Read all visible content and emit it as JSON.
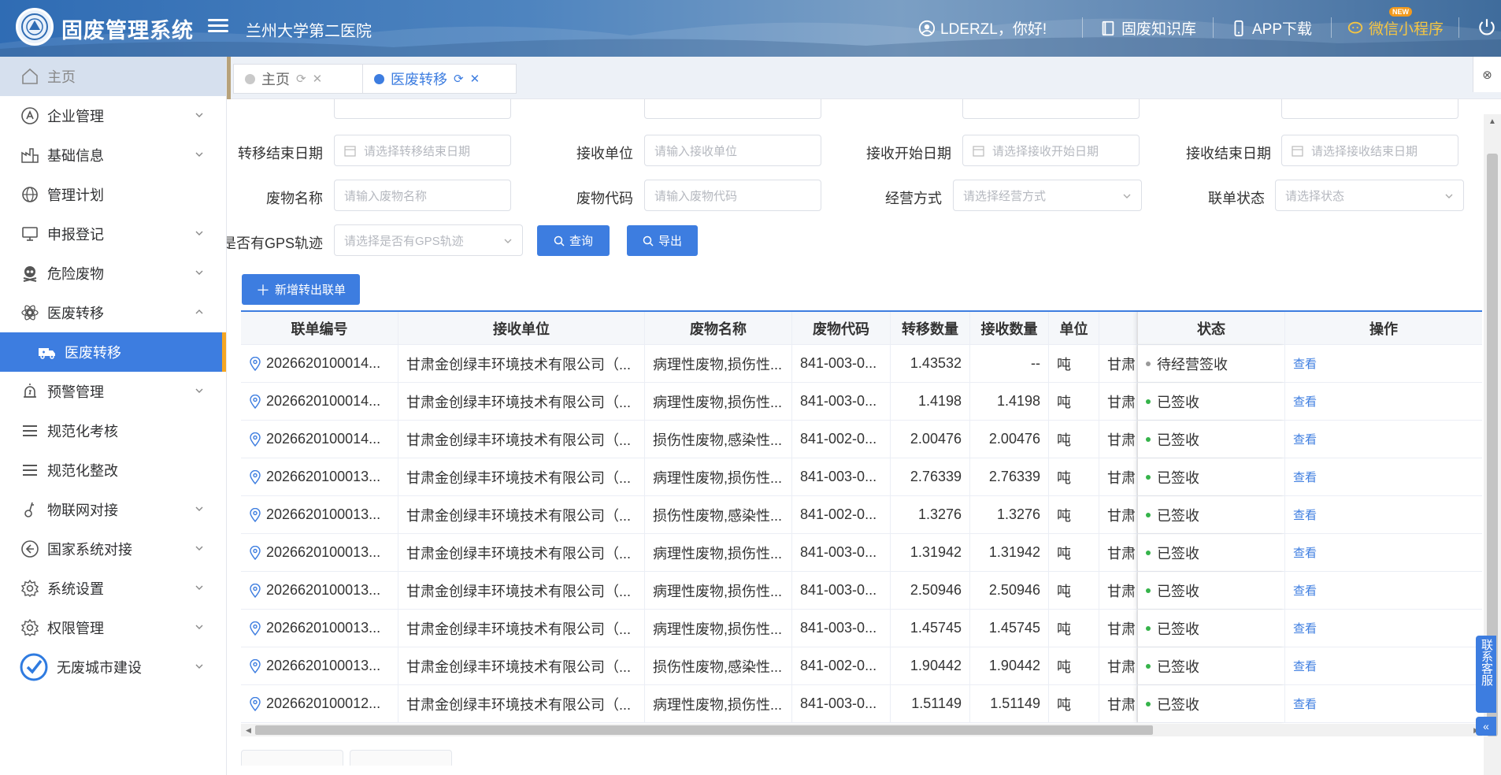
{
  "header": {
    "app_title": "固废管理系统",
    "org_name": "兰州大学第二医院",
    "greeting": "LDERZL，你好!",
    "knowledge": "固废知识库",
    "app_download": "APP下载",
    "mini_program": "微信小程序",
    "new_badge": "NEW"
  },
  "sidebar": {
    "items": [
      {
        "label": "主页",
        "icon": "home-icon"
      },
      {
        "label": "企业管理",
        "icon": "enterprise-icon"
      },
      {
        "label": "基础信息",
        "icon": "factory-icon"
      },
      {
        "label": "管理计划",
        "icon": "globe-icon"
      },
      {
        "label": "申报登记",
        "icon": "monitor-icon"
      },
      {
        "label": "危险废物",
        "icon": "skull-icon"
      },
      {
        "label": "医废转移",
        "icon": "medical-icon"
      },
      {
        "label": "医废转移",
        "icon": "truck-icon"
      },
      {
        "label": "预警管理",
        "icon": "alarm-icon"
      },
      {
        "label": "规范化考核",
        "icon": "list-icon"
      },
      {
        "label": "规范化整改",
        "icon": "list-icon"
      },
      {
        "label": "物联网对接",
        "icon": "iot-icon"
      },
      {
        "label": "国家系统对接",
        "icon": "back-arrow-icon"
      },
      {
        "label": "系统设置",
        "icon": "settings-icon"
      },
      {
        "label": "权限管理",
        "icon": "settings-icon"
      },
      {
        "label": "无废城市建设",
        "icon": "check-circle-icon"
      }
    ]
  },
  "tabs": [
    {
      "label": "主页"
    },
    {
      "label": "医废转移"
    }
  ],
  "filters": {
    "transfer_end_date": {
      "label": "转移结束日期",
      "placeholder": "请选择转移结束日期"
    },
    "receiver": {
      "label": "接收单位",
      "placeholder": "请输入接收单位"
    },
    "receive_start": {
      "label": "接收开始日期",
      "placeholder": "请选择接收开始日期"
    },
    "receive_end": {
      "label": "接收结束日期",
      "placeholder": "请选择接收结束日期"
    },
    "waste_name": {
      "label": "废物名称",
      "placeholder": "请输入废物名称"
    },
    "waste_code": {
      "label": "废物代码",
      "placeholder": "请输入废物代码"
    },
    "operation": {
      "label": "经营方式",
      "placeholder": "请选择经营方式"
    },
    "status": {
      "label": "联单状态",
      "placeholder": "请选择状态"
    },
    "gps": {
      "label": "是否有GPS轨迹",
      "placeholder": "请选择是否有GPS轨迹"
    }
  },
  "buttons": {
    "query": "查询",
    "export": "导出",
    "add": "新增转出联单"
  },
  "table": {
    "headers": [
      "联单编号",
      "接收单位",
      "废物名称",
      "废物代码",
      "转移数量",
      "接收数量",
      "单位",
      "",
      "状态",
      "操作"
    ],
    "rows": [
      {
        "id": "2026620100014...",
        "receiver": "甘肃金创绿丰环境技术有限公司（...",
        "waste": "病理性废物,损伤性...",
        "code": "841-003-0...",
        "qty": "1.43532",
        "recv": "--",
        "unit": "吨",
        "extra": "甘肃",
        "status": "待经营签收",
        "status_color": "#999999",
        "op": "查看"
      },
      {
        "id": "2026620100014...",
        "receiver": "甘肃金创绿丰环境技术有限公司（...",
        "waste": "病理性废物,损伤性...",
        "code": "841-003-0...",
        "qty": "1.4198",
        "recv": "1.4198",
        "unit": "吨",
        "extra": "甘肃",
        "status": "已签收",
        "status_color": "#35b34a",
        "op": "查看"
      },
      {
        "id": "2026620100014...",
        "receiver": "甘肃金创绿丰环境技术有限公司（...",
        "waste": "损伤性废物,感染性...",
        "code": "841-002-0...",
        "qty": "2.00476",
        "recv": "2.00476",
        "unit": "吨",
        "extra": "甘肃",
        "status": "已签收",
        "status_color": "#35b34a",
        "op": "查看"
      },
      {
        "id": "2026620100013...",
        "receiver": "甘肃金创绿丰环境技术有限公司（...",
        "waste": "病理性废物,损伤性...",
        "code": "841-003-0...",
        "qty": "2.76339",
        "recv": "2.76339",
        "unit": "吨",
        "extra": "甘肃",
        "status": "已签收",
        "status_color": "#35b34a",
        "op": "查看"
      },
      {
        "id": "2026620100013...",
        "receiver": "甘肃金创绿丰环境技术有限公司（...",
        "waste": "损伤性废物,感染性...",
        "code": "841-002-0...",
        "qty": "1.3276",
        "recv": "1.3276",
        "unit": "吨",
        "extra": "甘肃",
        "status": "已签收",
        "status_color": "#35b34a",
        "op": "查看"
      },
      {
        "id": "2026620100013...",
        "receiver": "甘肃金创绿丰环境技术有限公司（...",
        "waste": "病理性废物,损伤性...",
        "code": "841-003-0...",
        "qty": "1.31942",
        "recv": "1.31942",
        "unit": "吨",
        "extra": "甘肃",
        "status": "已签收",
        "status_color": "#35b34a",
        "op": "查看"
      },
      {
        "id": "2026620100013...",
        "receiver": "甘肃金创绿丰环境技术有限公司（...",
        "waste": "病理性废物,损伤性...",
        "code": "841-003-0...",
        "qty": "2.50946",
        "recv": "2.50946",
        "unit": "吨",
        "extra": "甘肃",
        "status": "已签收",
        "status_color": "#35b34a",
        "op": "查看"
      },
      {
        "id": "2026620100013...",
        "receiver": "甘肃金创绿丰环境技术有限公司（...",
        "waste": "病理性废物,损伤性...",
        "code": "841-003-0...",
        "qty": "1.45745",
        "recv": "1.45745",
        "unit": "吨",
        "extra": "甘肃",
        "status": "已签收",
        "status_color": "#35b34a",
        "op": "查看"
      },
      {
        "id": "2026620100013...",
        "receiver": "甘肃金创绿丰环境技术有限公司（...",
        "waste": "损伤性废物,感染性...",
        "code": "841-002-0...",
        "qty": "1.90442",
        "recv": "1.90442",
        "unit": "吨",
        "extra": "甘肃",
        "status": "已签收",
        "status_color": "#35b34a",
        "op": "查看"
      },
      {
        "id": "2026620100012...",
        "receiver": "甘肃金创绿丰环境技术有限公司（...",
        "waste": "病理性废物,损伤性...",
        "code": "841-003-0...",
        "qty": "1.51149",
        "recv": "1.51149",
        "unit": "吨",
        "extra": "甘肃",
        "status": "已签收",
        "status_color": "#35b34a",
        "op": "查看"
      }
    ]
  },
  "service": {
    "label": "联系客服"
  },
  "colors": {
    "accent": "#3d7de0",
    "active_bar": "#f5a623",
    "signed": "#35b34a",
    "pending": "#999999"
  }
}
